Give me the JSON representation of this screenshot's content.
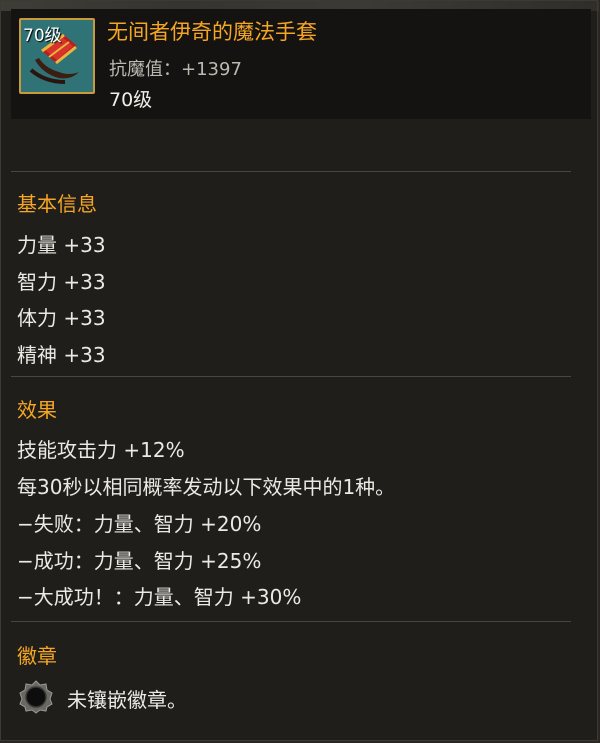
{
  "item": {
    "icon_name": "red-magic-glove-icon",
    "icon_level_badge": "70级",
    "name": "无间者伊奇的魔法手套",
    "resist_line": "抗魔值：+1397",
    "required_level": "70级",
    "name_color": "#f5a623"
  },
  "basic_info": {
    "title": "基本信息",
    "stats": [
      "力量 +33",
      "智力 +33",
      "体力 +33",
      "精神 +33"
    ]
  },
  "effect": {
    "title": "效果",
    "lines": [
      "技能攻击力 +12%",
      "每30秒以相同概率发动以下效果中的1种。",
      "−失败：力量、智力 +20%",
      "−成功：力量、智力 +25%",
      "−大成功！：力量、智力 +30%"
    ]
  },
  "badge": {
    "title": "徽章",
    "slot_icon": "empty-badge-slot-icon",
    "slot_text": "未镶嵌徽章。"
  }
}
